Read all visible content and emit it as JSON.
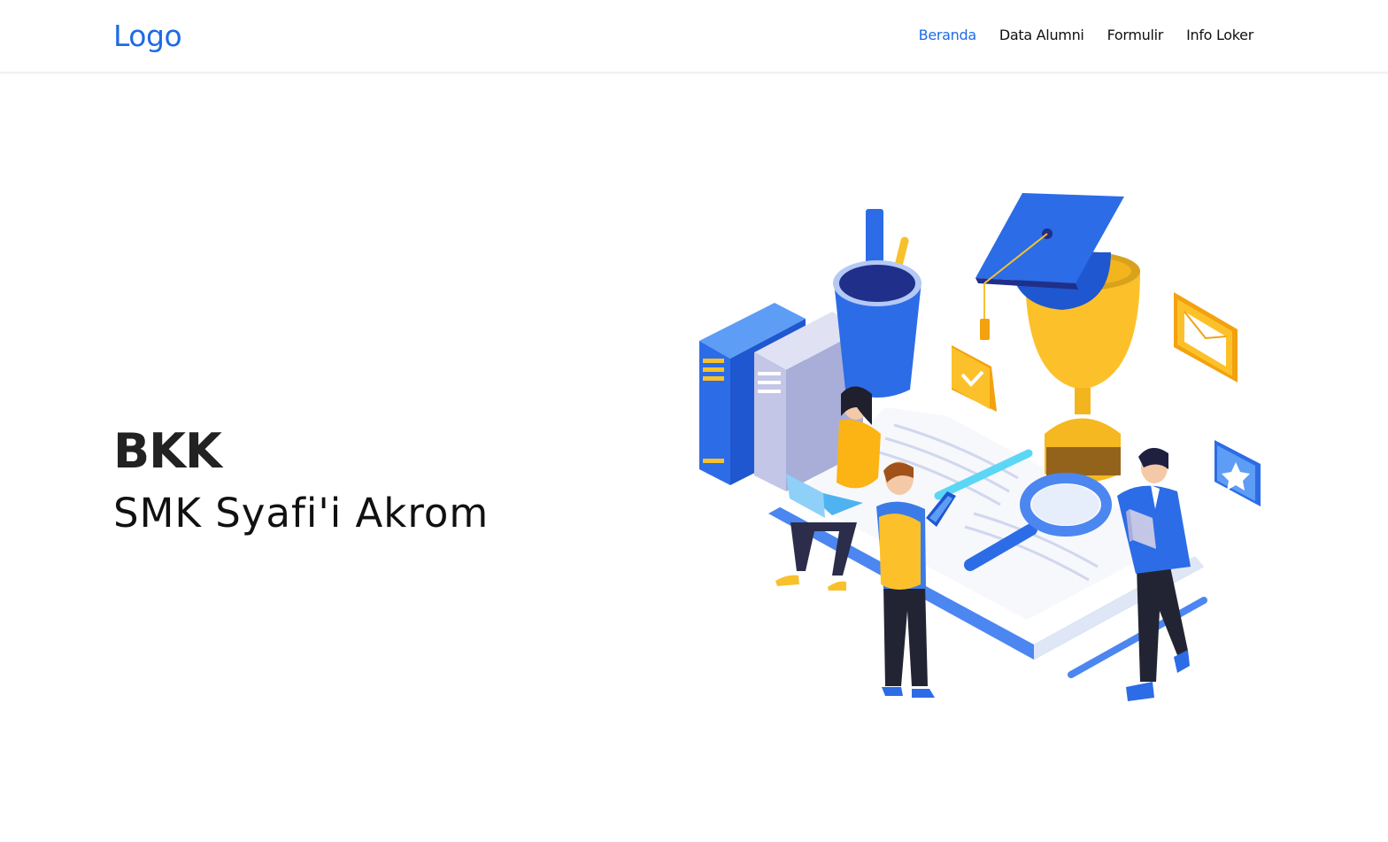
{
  "nav": {
    "logo": "Logo",
    "links": [
      {
        "label": "Beranda",
        "active": true
      },
      {
        "label": "Data Alumni",
        "active": false
      },
      {
        "label": "Formulir",
        "active": false
      },
      {
        "label": "Info Loker",
        "active": false
      }
    ]
  },
  "hero": {
    "title": "BKK",
    "subtitle": "SMK Syafi'i Akrom"
  },
  "colors": {
    "brand": "#1e6be6",
    "text_dark": "#222222",
    "accent_yellow": "#f8c12b"
  },
  "illustration": {
    "icons": [
      "books-icon",
      "pencil-cup-icon",
      "graduation-cap-icon",
      "trophy-icon",
      "check-badge-icon",
      "envelope-icon",
      "star-badge-icon",
      "magnifier-icon"
    ]
  }
}
